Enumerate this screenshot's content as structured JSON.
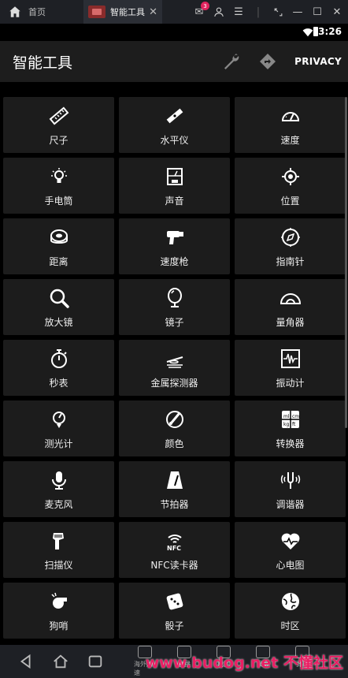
{
  "emulator": {
    "home_tab": "首页",
    "app_tab": "智能工具",
    "close": "✕",
    "mail_badge": "3"
  },
  "status": {
    "time": "3:26"
  },
  "appbar": {
    "title": "智能工具",
    "privacy": "PRIVACY"
  },
  "tools": [
    {
      "label": "尺子",
      "icon": "ruler-icon"
    },
    {
      "label": "水平仪",
      "icon": "level-icon"
    },
    {
      "label": "速度",
      "icon": "speedometer-icon"
    },
    {
      "label": "手电筒",
      "icon": "flashlight-icon"
    },
    {
      "label": "声音",
      "icon": "sound-meter-icon"
    },
    {
      "label": "位置",
      "icon": "location-icon"
    },
    {
      "label": "距离",
      "icon": "tape-measure-icon"
    },
    {
      "label": "速度枪",
      "icon": "speed-gun-icon"
    },
    {
      "label": "指南针",
      "icon": "compass-icon"
    },
    {
      "label": "放大镜",
      "icon": "magnifier-icon"
    },
    {
      "label": "镜子",
      "icon": "mirror-icon"
    },
    {
      "label": "量角器",
      "icon": "protractor-icon"
    },
    {
      "label": "秒表",
      "icon": "stopwatch-icon"
    },
    {
      "label": "金属探测器",
      "icon": "metal-detector-icon"
    },
    {
      "label": "振动计",
      "icon": "vibrometer-icon"
    },
    {
      "label": "测光计",
      "icon": "light-meter-icon"
    },
    {
      "label": "颜色",
      "icon": "color-icon"
    },
    {
      "label": "转换器",
      "icon": "converter-icon"
    },
    {
      "label": "麦克风",
      "icon": "microphone-icon"
    },
    {
      "label": "节拍器",
      "icon": "metronome-icon"
    },
    {
      "label": "调谐器",
      "icon": "tuning-fork-icon"
    },
    {
      "label": "扫描仪",
      "icon": "scanner-icon"
    },
    {
      "label": "NFC读卡器",
      "icon": "nfc-icon"
    },
    {
      "label": "心电图",
      "icon": "heart-rate-icon"
    },
    {
      "label": "狗哨",
      "icon": "whistle-icon"
    },
    {
      "label": "骰子",
      "icon": "dice-icon"
    },
    {
      "label": "时区",
      "icon": "globe-icon"
    }
  ],
  "navbar": {
    "tools": [
      "海外加速",
      "直播",
      "截图",
      "录屏",
      "弹幕"
    ]
  },
  "watermark": "www.budog.net 不懂社区"
}
